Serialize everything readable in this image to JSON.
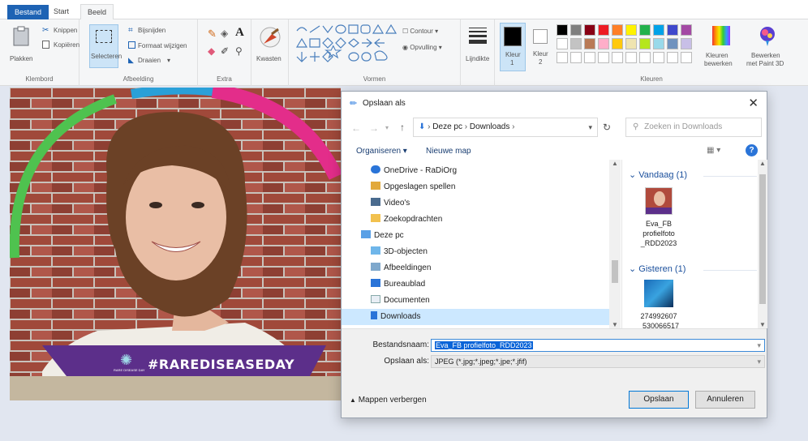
{
  "tabs": {
    "file": "Bestand",
    "start": "Start",
    "view": "Beeld"
  },
  "ribbon": {
    "clipboard": {
      "paste": "Plakken",
      "cut": "Knippen",
      "copy": "Kopiëren",
      "caption": "Klembord"
    },
    "image": {
      "select": "Selecteren",
      "crop": "Bijsnijden",
      "resize": "Formaat wijzigen",
      "rotate": "Draaien",
      "caption": "Afbeelding"
    },
    "tools": {
      "caption": "Extra"
    },
    "brushes": {
      "label": "Kwasten"
    },
    "shapes": {
      "outline": "Contour",
      "fill": "Opvulling",
      "caption": "Vormen"
    },
    "size": {
      "label": "Lijndikte"
    },
    "colors": {
      "color1_label": "Kleur",
      "color1_num": "1",
      "color2_label": "Kleur",
      "color2_num": "2",
      "edit_l1": "Kleuren",
      "edit_l2": "bewerken",
      "paint3d_l1": "Bewerken",
      "paint3d_l2": "met Paint 3D",
      "caption": "Kleuren"
    }
  },
  "colors": {
    "accent": "#1e63b4",
    "palette_row1": [
      "#000000",
      "#7f7f7f",
      "#880015",
      "#ed1c24",
      "#ff7f27",
      "#fff200",
      "#22b14c",
      "#00a2e8",
      "#3f48cc",
      "#a349a4"
    ],
    "palette_row2": [
      "#ffffff",
      "#c3c3c3",
      "#b97a57",
      "#ffaec9",
      "#ffc90e",
      "#efe4b0",
      "#b5e61d",
      "#99d9ea",
      "#7092be",
      "#c8bfe7"
    ]
  },
  "canvas": {
    "banner_text": "#RAREDISEASEDAY",
    "banner_small": "RARE DISEASE DAY"
  },
  "dialog": {
    "title": "Opslaan als",
    "breadcrumb": [
      "Deze pc",
      "Downloads"
    ],
    "search_placeholder": "Zoeken in Downloads",
    "organize": "Organiseren",
    "new_folder": "Nieuwe map",
    "nav_items": [
      "OneDrive - RaDiOrg",
      "Opgeslagen spellen",
      "Video's",
      "Zoekopdrachten",
      "Deze pc",
      "3D-objecten",
      "Afbeeldingen",
      "Bureaublad",
      "Documenten",
      "Downloads"
    ],
    "group_today": "Vandaag (1)",
    "file1": [
      "Eva_FB",
      "profielfoto",
      "_RDD2023"
    ],
    "group_yesterday": "Gisteren (1)",
    "file2": [
      "274992607",
      "_530066517"
    ],
    "filename_label": "Bestandsnaam:",
    "filename_value": "Eva_FB profielfoto_RDD2023",
    "savetype_label": "Opslaan als:",
    "savetype_value": "JPEG (*.jpg;*.jpeg;*.jpe;*.jfif)",
    "hide_folders": "Mappen verbergen",
    "save": "Opslaan",
    "cancel": "Annuleren"
  }
}
